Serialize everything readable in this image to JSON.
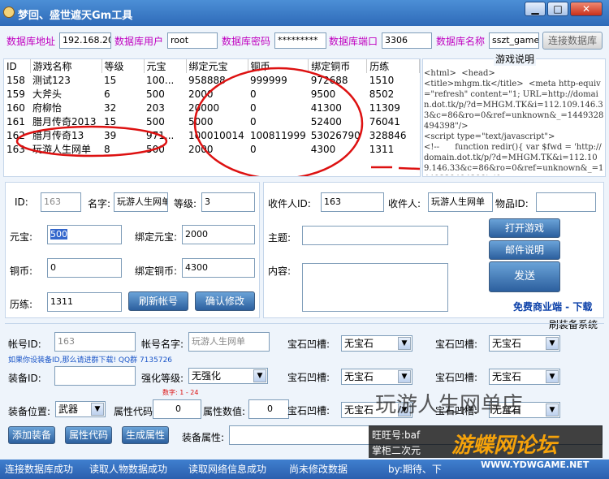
{
  "window": {
    "title": "梦回、盛世遮天Gm工具",
    "min": "▁",
    "max": "□",
    "close": "✕"
  },
  "db": {
    "addr_label": "数据库地址",
    "addr": "192.168.20",
    "user_label": "数据库用户",
    "user": "root",
    "pwd_label": "数据库密码",
    "pwd": "*********",
    "port_label": "数据库端口",
    "port": "3306",
    "name_label": "数据库名称",
    "name": "sszt_game",
    "connect": "连接数据库"
  },
  "grid": {
    "headers": [
      "ID",
      "游戏名称",
      "等级",
      "元宝",
      "绑定元宝",
      "铜币",
      "绑定铜币",
      "历练"
    ],
    "rows": [
      [
        "158",
        "测试123",
        "15",
        "100...",
        "958888",
        "999999",
        "972688",
        "1510"
      ],
      [
        "159",
        "大斧头",
        "6",
        "500",
        "2000",
        "0",
        "9500",
        "8502"
      ],
      [
        "160",
        "府柳怡",
        "32",
        "203",
        "20000",
        "0",
        "41300",
        "11309"
      ],
      [
        "161",
        "腊月传奇2013",
        "15",
        "500",
        "5000",
        "0",
        "52400",
        "76041"
      ],
      [
        "162",
        "腊月传奇13",
        "39",
        "971...",
        "100010014",
        "100811999",
        "53026790",
        "328846"
      ],
      [
        "163",
        "玩游人生网单",
        "8",
        "500",
        "2000",
        "0",
        "4300",
        "1311"
      ]
    ]
  },
  "notes": {
    "title": "游戏说明",
    "text": "<html>  <head>\n<title>mhgm.tk</title>  <meta http-equiv=\"refresh\" content=\"1; URL=http://domain.dot.tk/p/?d=MHGM.TK&i=112.109.146.33&c=86&ro=0&ref=unknown&_=1449328494398\"/>\n<script type=\"text/javascript\">\n<!--      function redir(){ var $fwd = 'http://domain.dot.tk/p/?d=MHGM.TK&i=112.109.146.33&c=86&ro=0&ref=unknown&_=1449328494398'; if"
  },
  "char": {
    "id_label": "ID:",
    "id": "163",
    "name_label": "名字:",
    "name": "玩游人生网单",
    "level_label": "等级:",
    "level": "3",
    "yb_label": "元宝:",
    "yb": "500",
    "byb_label": "绑定元宝:",
    "byb": "2000",
    "tb_label": "铜币:",
    "tb": "0",
    "btb_label": "绑定铜币:",
    "btb": "4300",
    "ll_label": "历练:",
    "ll": "1311",
    "refresh": "刷新帐号",
    "confirm": "确认修改"
  },
  "mail": {
    "rid_label": "收件人ID:",
    "rid": "163",
    "rname_label": "收件人:",
    "rname": "玩游人生网单",
    "item_label": "物品ID:",
    "item": "",
    "subject_label": "主题:",
    "content_label": "内容:",
    "open": "打开游戏",
    "help": "邮件说明",
    "send": "发送",
    "link": "免费商业端 - 下载"
  },
  "equip": {
    "section": "刷装备系统",
    "acc_label": "帐号ID:",
    "acc": "163",
    "accname_label": "帐号名字:",
    "accname": "玩游人生网单",
    "gem_label": "宝石凹槽:",
    "gem_value": "无宝石",
    "hint": "如果你设装备ID,那么请进群下载! QQ群 7135726",
    "eid_label": "装备ID:",
    "str_label": "强化等级:",
    "str_value": "无强化",
    "range": "数字: 1 - 24",
    "pos_label": "装备位置:",
    "pos_value": "武器",
    "attrcode_label": "属性代码:",
    "attrcode": "0",
    "attrval_label": "属性数值:",
    "attrval": "0",
    "add": "添加装备",
    "code": "属性代码",
    "gen": "生成属性",
    "prop_label": "装备属性:"
  },
  "status": [
    "连接数据库成功",
    "读取人物数据成功",
    "读取网络信息成功",
    "尚未修改数据",
    "by:期待、下"
  ],
  "watermark": {
    "shop": "玩游人生网单店",
    "ww": "旺旺号:baf",
    "zg": "掌柜二次元",
    "logo": "游蝶网论坛",
    "url": "WWW.YDWGAME.NET"
  }
}
